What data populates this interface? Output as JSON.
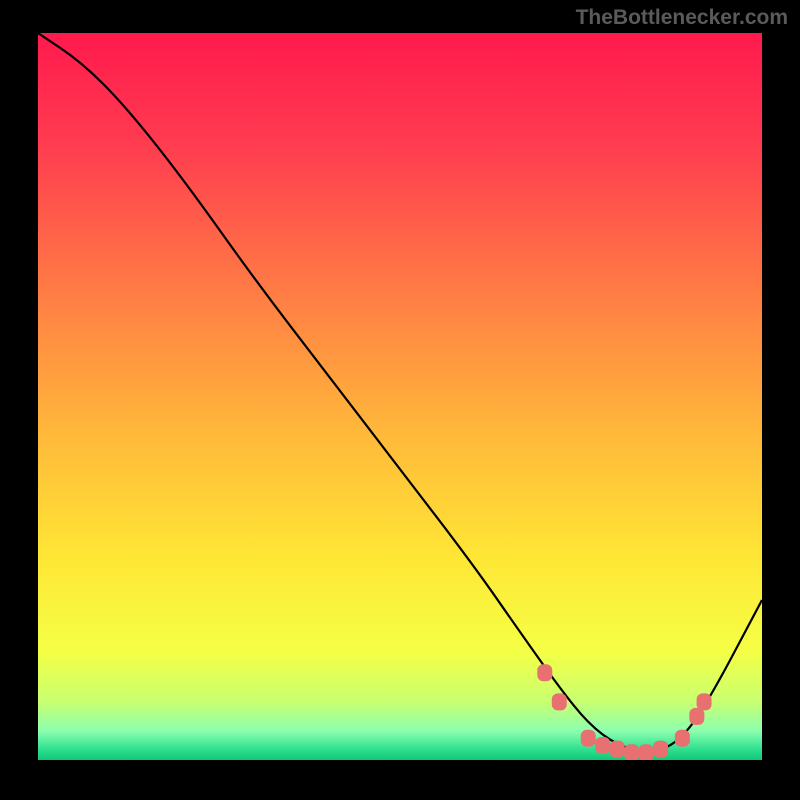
{
  "watermark": "TheBottlenecker.com",
  "chart_data": {
    "type": "line",
    "title": "",
    "xlabel": "",
    "ylabel": "",
    "xlim": [
      0,
      100
    ],
    "ylim": [
      0,
      100
    ],
    "background": "rainbow-vertical-gradient",
    "series": [
      {
        "name": "curve",
        "color": "#000000",
        "x": [
          0,
          6,
          12,
          20,
          30,
          40,
          50,
          60,
          67,
          72,
          76,
          80,
          84,
          88,
          92,
          100
        ],
        "y": [
          100,
          96,
          90,
          80,
          66,
          53,
          40,
          27,
          17,
          10,
          5,
          2,
          1,
          2,
          7,
          22
        ]
      }
    ],
    "markers": {
      "name": "highlight-points",
      "color": "#e97070",
      "shape": "rounded-rect",
      "points": [
        {
          "x": 70,
          "y": 12
        },
        {
          "x": 72,
          "y": 8
        },
        {
          "x": 76,
          "y": 3
        },
        {
          "x": 78,
          "y": 2
        },
        {
          "x": 80,
          "y": 1.5
        },
        {
          "x": 82,
          "y": 1
        },
        {
          "x": 84,
          "y": 1
        },
        {
          "x": 86,
          "y": 1.5
        },
        {
          "x": 89,
          "y": 3
        },
        {
          "x": 91,
          "y": 6
        },
        {
          "x": 92,
          "y": 8
        }
      ]
    },
    "gradient_stops": [
      {
        "offset": 0,
        "color": "#ff1a4d"
      },
      {
        "offset": 0.15,
        "color": "#ff3b50"
      },
      {
        "offset": 0.35,
        "color": "#ff7a45"
      },
      {
        "offset": 0.55,
        "color": "#ffb83a"
      },
      {
        "offset": 0.72,
        "color": "#ffe635"
      },
      {
        "offset": 0.85,
        "color": "#f5ff45"
      },
      {
        "offset": 0.92,
        "color": "#c8ff70"
      },
      {
        "offset": 0.96,
        "color": "#8cffb0"
      },
      {
        "offset": 0.985,
        "color": "#30e090"
      },
      {
        "offset": 1,
        "color": "#10c878"
      }
    ]
  }
}
